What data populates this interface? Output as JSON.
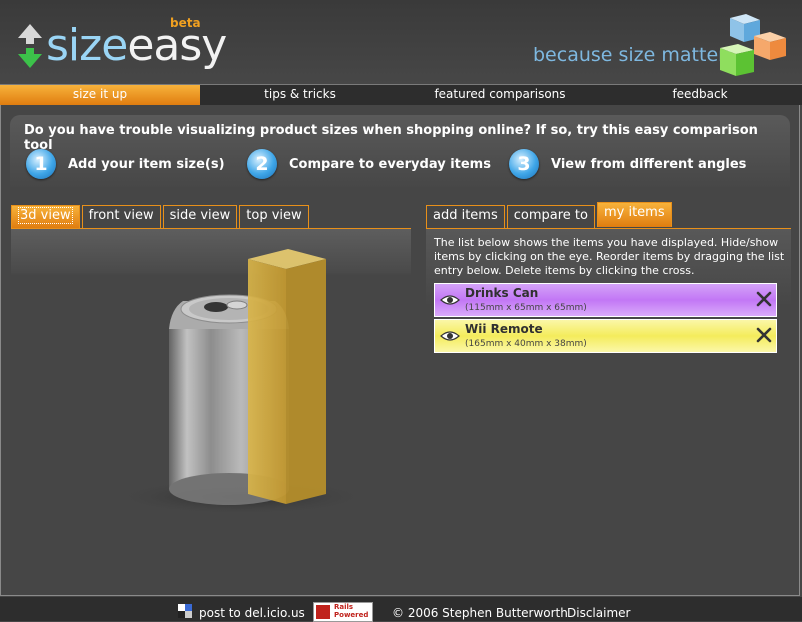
{
  "brand": {
    "logo_size": "size",
    "logo_easy": "easy",
    "beta": "beta",
    "tagline": "because size matters"
  },
  "nav": {
    "items": [
      "size it up",
      "tips & tricks",
      "featured comparisons",
      "feedback"
    ],
    "active_index": 0
  },
  "banner": {
    "question": "Do you have trouble visualizing product sizes when shopping online? If so, try this easy comparison tool",
    "steps": [
      {
        "num": "1",
        "label": "Add your item size(s)"
      },
      {
        "num": "2",
        "label": "Compare to everyday items"
      },
      {
        "num": "3",
        "label": "View from different angles"
      }
    ]
  },
  "view_tabs": [
    "3d view",
    "front view",
    "side view",
    "top view"
  ],
  "item_tabs": [
    "add items",
    "compare to",
    "my items"
  ],
  "my_items": {
    "description": "The list below shows the items you have displayed. Hide/show items by clicking on the eye. Reorder items by dragging the list entry below. Delete items by clicking the cross.",
    "items": [
      {
        "name": "Drinks Can",
        "dims": "(115mm x 65mm x 65mm)",
        "color": "#c77ef5"
      },
      {
        "name": "Wii Remote",
        "dims": "(165mm x 40mm x 38mm)",
        "color": "#f6f06a"
      }
    ]
  },
  "footer": {
    "delicious": "post to del.icio.us",
    "rails_badge_1": "Rails",
    "rails_badge_2": "Powered",
    "copyright": "© 2006 Stephen Butterworth",
    "disclaimer": "Disclaimer"
  },
  "colors": {
    "accent": "#e8901a",
    "background": "#464646"
  }
}
